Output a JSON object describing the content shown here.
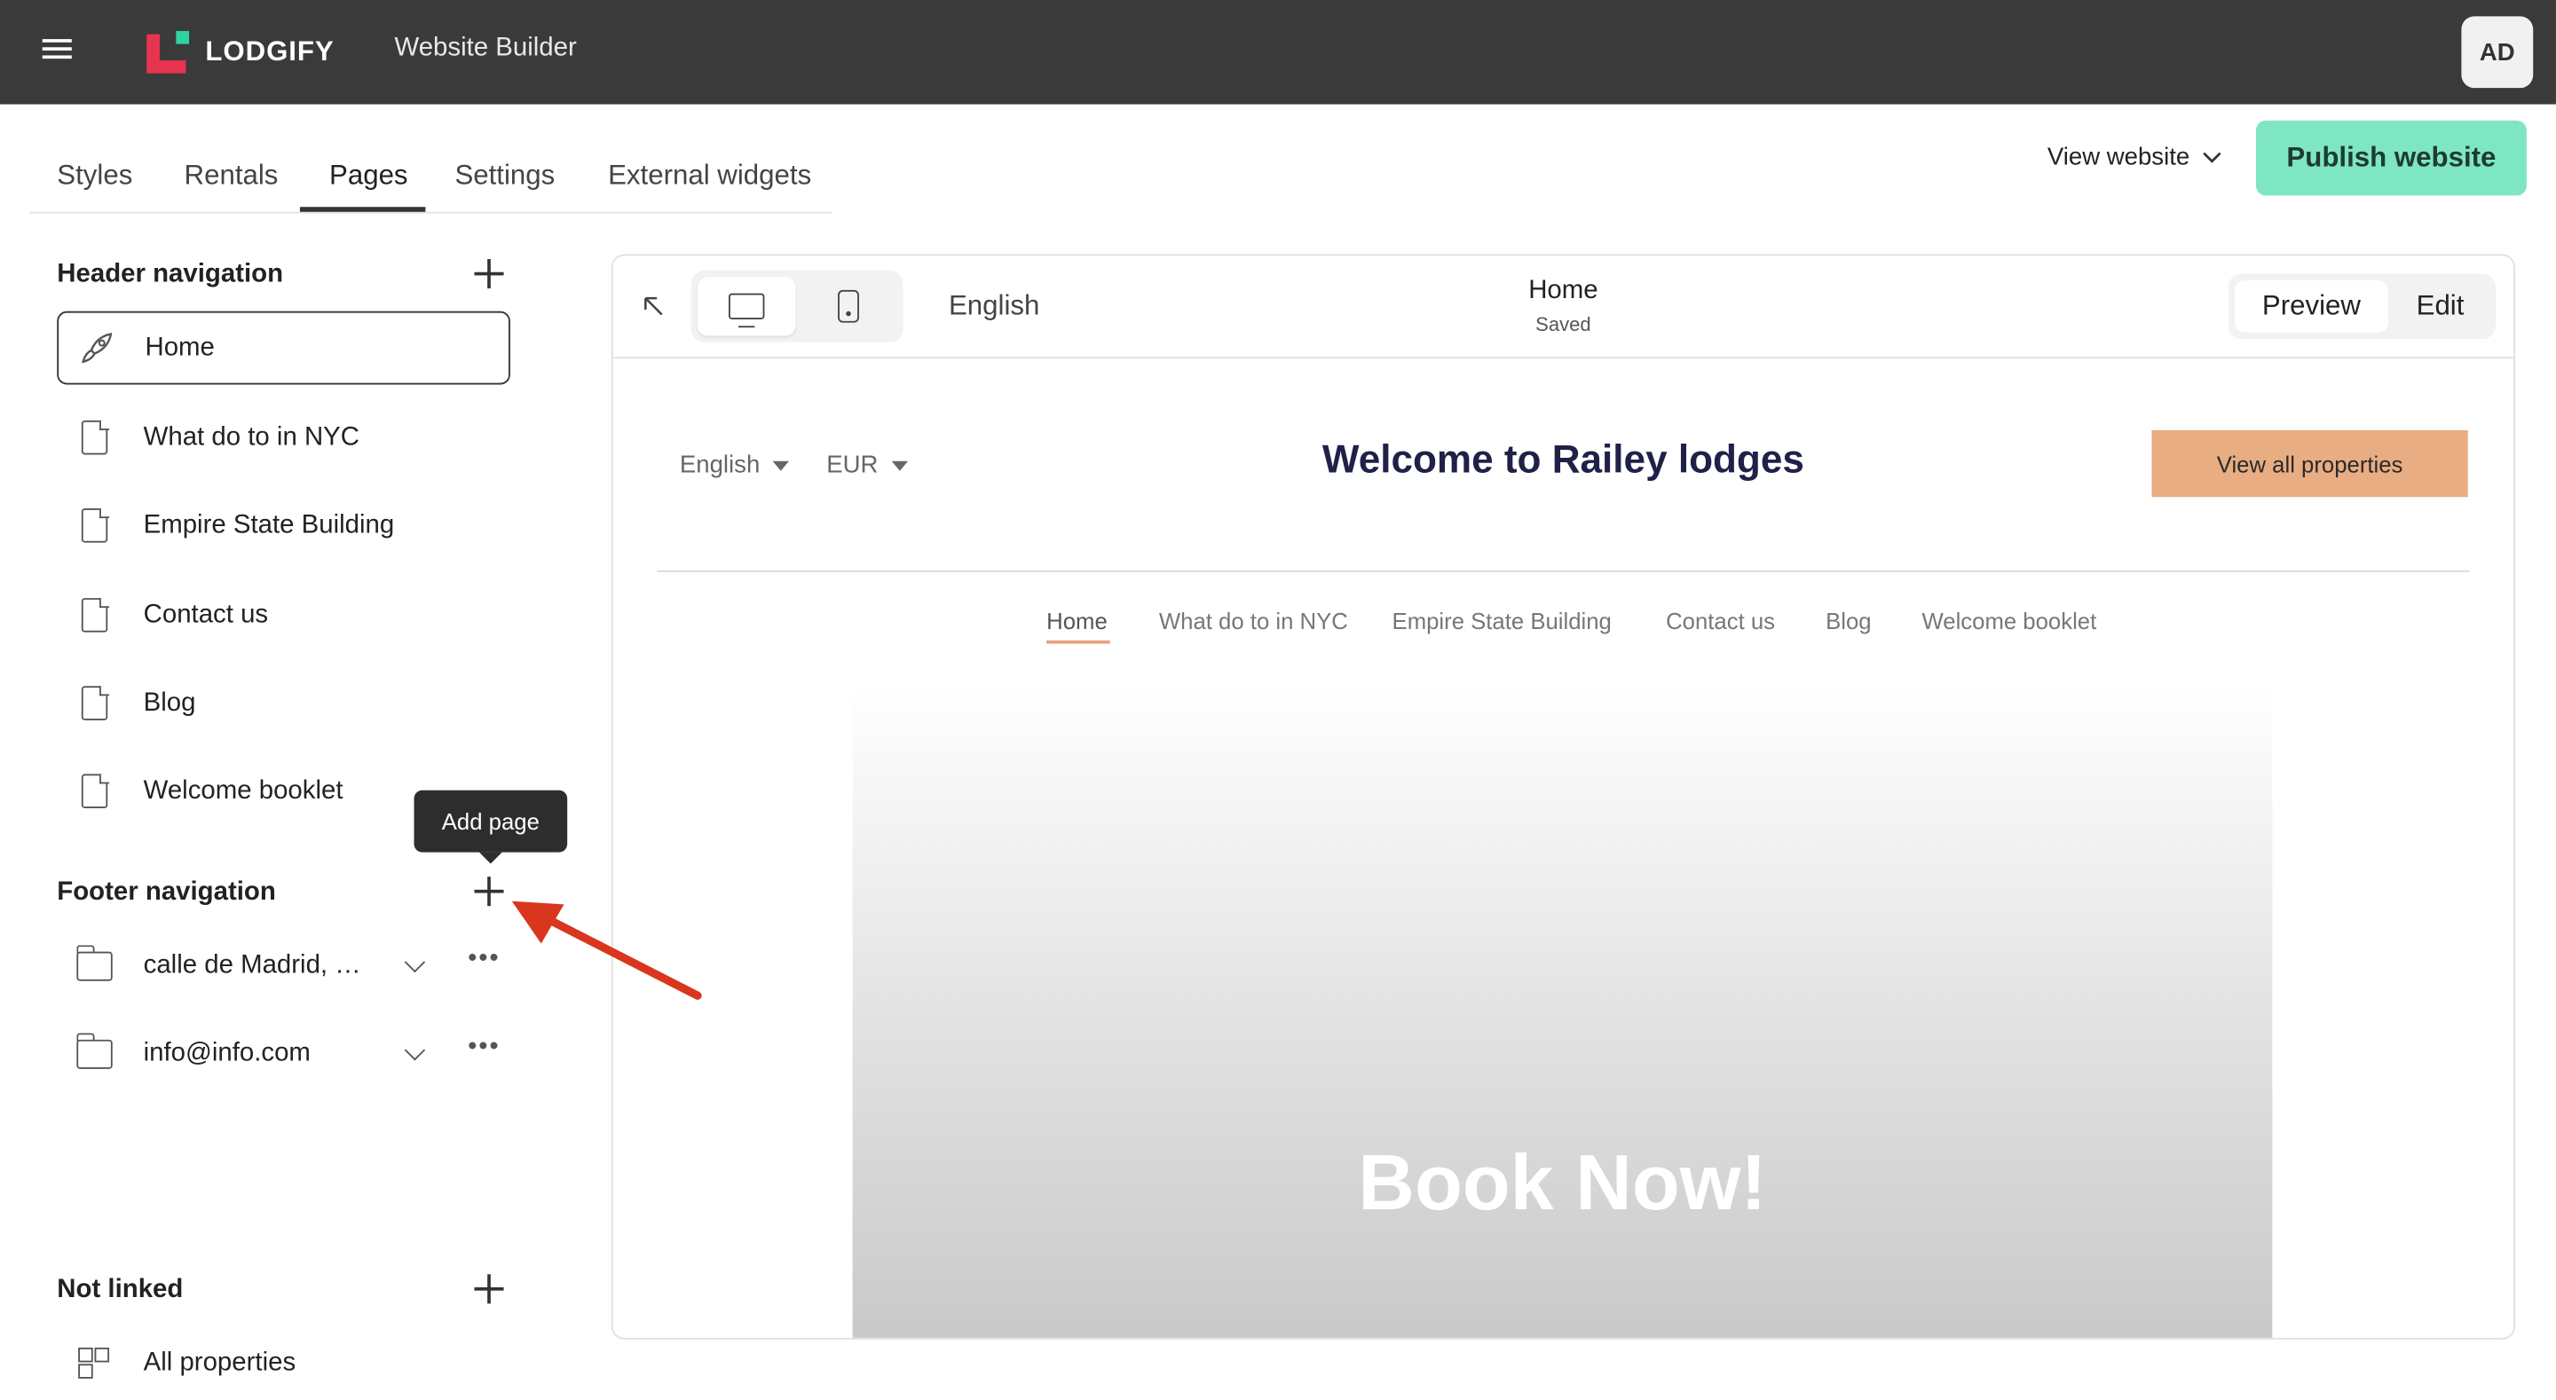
{
  "app": {
    "brand": "LODGIFY",
    "title": "Website Builder",
    "user_initials": "AD"
  },
  "tabs": [
    {
      "label": "Styles"
    },
    {
      "label": "Rentals"
    },
    {
      "label": "Pages",
      "active": true
    },
    {
      "label": "Settings"
    },
    {
      "label": "External widgets"
    }
  ],
  "header_actions": {
    "view_website": "View website",
    "publish": "Publish website"
  },
  "sidebar": {
    "header_nav": {
      "title": "Header navigation",
      "items": [
        {
          "label": "Home",
          "icon": "rocket-icon",
          "selected": true
        },
        {
          "label": "What do to in NYC",
          "icon": "page-icon"
        },
        {
          "label": "Empire State Building",
          "icon": "page-icon"
        },
        {
          "label": "Contact us",
          "icon": "page-icon"
        },
        {
          "label": "Blog",
          "icon": "page-icon"
        },
        {
          "label": "Welcome booklet",
          "icon": "page-icon"
        }
      ]
    },
    "tooltip": "Add page",
    "footer_nav": {
      "title": "Footer navigation",
      "items": [
        {
          "label": "calle de Madrid, …",
          "icon": "folder-icon"
        },
        {
          "label": "info@info.com",
          "icon": "folder-icon"
        }
      ]
    },
    "not_linked": {
      "title": "Not linked",
      "items": [
        {
          "label": "All properties",
          "icon": "grid-icon"
        }
      ]
    }
  },
  "preview": {
    "language": "English",
    "page_name": "Home",
    "status": "Saved",
    "modes": [
      "Preview",
      "Edit"
    ],
    "active_mode": "Preview",
    "site": {
      "language": "English",
      "currency": "EUR",
      "title": "Welcome to Railey lodges",
      "cta": "View all properties",
      "nav": [
        "Home",
        "What do to in NYC",
        "Empire State Building",
        "Contact us",
        "Blog",
        "Welcome booklet"
      ],
      "active_nav": "Home",
      "hero_text": "Book Now!"
    }
  },
  "colors": {
    "topbar": "#3a3a3a",
    "publish": "#7ee6c3",
    "cta": "#e8ad82",
    "title": "#1f2148",
    "arrow": "#d9361e"
  }
}
